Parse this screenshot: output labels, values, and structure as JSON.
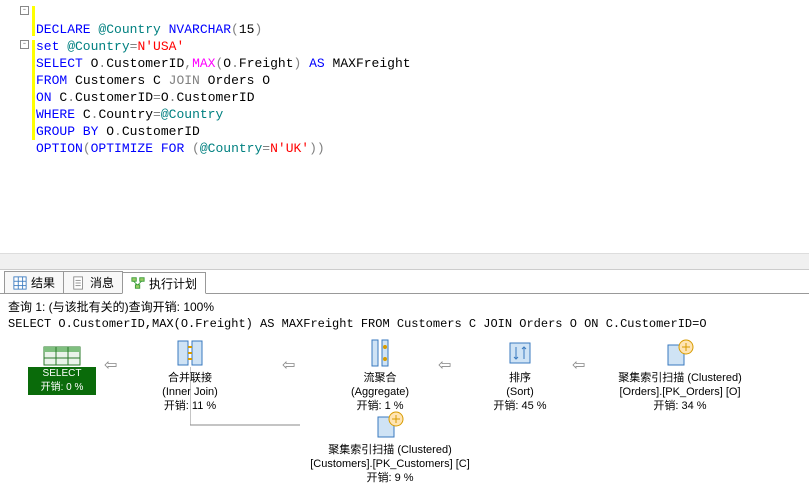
{
  "code": {
    "line1": {
      "a": "DECLARE",
      "b": " @Country ",
      "c": "NVARCHAR",
      "d": "(",
      "e": "15",
      "f": ")"
    },
    "line2": {
      "a": "set",
      "b": " @Country",
      "c": "=",
      "d": "N'USA'"
    },
    "line3": {
      "a": "SELECT",
      "b": " O",
      "c": ".",
      "d": "CustomerID",
      "e": ",",
      "f": "MAX",
      "g": "(",
      "h": "O",
      "i": ".",
      "j": "Freight",
      "k": ")",
      "l": " AS",
      "m": " MAXFreight"
    },
    "line4": {
      "a": "FROM",
      "b": " Customers C ",
      "c": "JOIN",
      "d": " Orders O"
    },
    "line5": {
      "a": "ON",
      "b": " C",
      "c": ".",
      "d": "CustomerID",
      "e": "=",
      "f": "O",
      "g": ".",
      "h": "CustomerID"
    },
    "line6": {
      "a": "WHERE",
      "b": " C",
      "c": ".",
      "d": "Country",
      "e": "=",
      "f": "@Country"
    },
    "line7": {
      "a": "GROUP BY",
      "b": " O",
      "c": ".",
      "d": "CustomerID"
    },
    "line8": {
      "a": "OPTION",
      "b": "(",
      "c": "OPTIMIZE FOR ",
      "d": "(",
      "e": "@Country",
      "f": "=",
      "g": "N'UK'",
      "h": "))"
    }
  },
  "tabs": {
    "results": "结果",
    "messages": "消息",
    "plan": "执行计划"
  },
  "plan": {
    "header": "查询 1: (与该批有关的)查询开销: 100%",
    "sql": "SELECT O.CustomerID,MAX(O.Freight) AS MAXFreight FROM Customers C JOIN Orders O ON C.CustomerID=O",
    "select": {
      "label": "SELECT",
      "cost": "开销: 0 %"
    },
    "nodes": {
      "join": {
        "label": "合并联接",
        "sub": "(Inner Join)",
        "cost": "开销: 11 %"
      },
      "agg": {
        "label": "流聚合",
        "sub": "(Aggregate)",
        "cost": "开销: 1 %"
      },
      "sort": {
        "label": "排序",
        "sub": "(Sort)",
        "cost": "开销: 45 %"
      },
      "scan1": {
        "label": "聚集索引扫描",
        "sub": "(Clustered)",
        "obj": "[Orders].[PK_Orders] [O]",
        "cost": "开销: 34 %"
      },
      "scan2": {
        "label": "聚集索引扫描",
        "sub": "(Clustered)",
        "obj": "[Customers].[PK_Customers] [C]",
        "cost": "开销: 9 %"
      }
    }
  },
  "arrows": {
    "left": "⇦"
  }
}
